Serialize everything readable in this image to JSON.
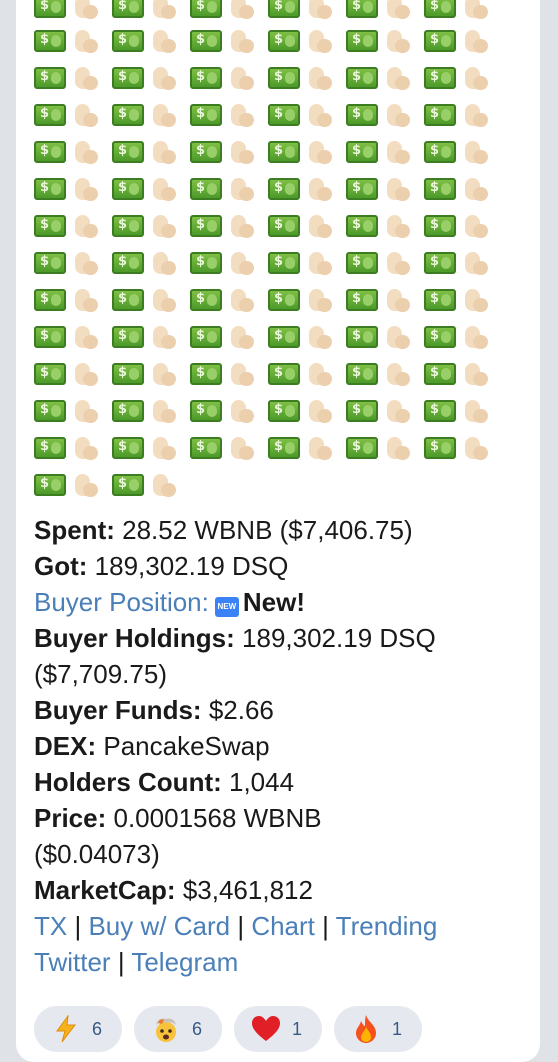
{
  "emoji_pattern": [
    "cash-emoji",
    "flexed-biceps-emoji"
  ],
  "emoji_rows": 14,
  "emoji_last_row_pairs": 2,
  "message": {
    "spent_label": "Spent:",
    "spent_value": "28.52 WBNB ($7,406.75)",
    "got_label": "Got:",
    "got_value": "189,302.19 DSQ",
    "buyer_position_label": "Buyer Position:",
    "new_badge": "NEW",
    "new_text": "New!",
    "holdings_label": "Buyer Holdings:",
    "holdings_value": "189,302.19 DSQ",
    "holdings_usd": "($7,709.75)",
    "funds_label": "Buyer Funds:",
    "funds_value": "$2.66",
    "dex_label": "DEX:",
    "dex_value": "PancakeSwap",
    "holders_label": "Holders Count:",
    "holders_value": "1,044",
    "price_label": "Price:",
    "price_value": "0.0001568 WBNB",
    "price_usd": "($0.04073)",
    "mcap_label": "MarketCap:",
    "mcap_value": "$3,461,812",
    "links": {
      "tx": "TX",
      "buy_card": "Buy w/ Card",
      "chart": "Chart",
      "trending": "Trending",
      "twitter": "Twitter",
      "telegram": "Telegram",
      "separator": "|"
    }
  },
  "reactions": [
    {
      "icon": "lightning-icon",
      "count": "6"
    },
    {
      "icon": "exploding-head-icon",
      "count": "6"
    },
    {
      "icon": "heart-icon",
      "count": "1"
    },
    {
      "icon": "fire-icon",
      "count": "1"
    }
  ]
}
